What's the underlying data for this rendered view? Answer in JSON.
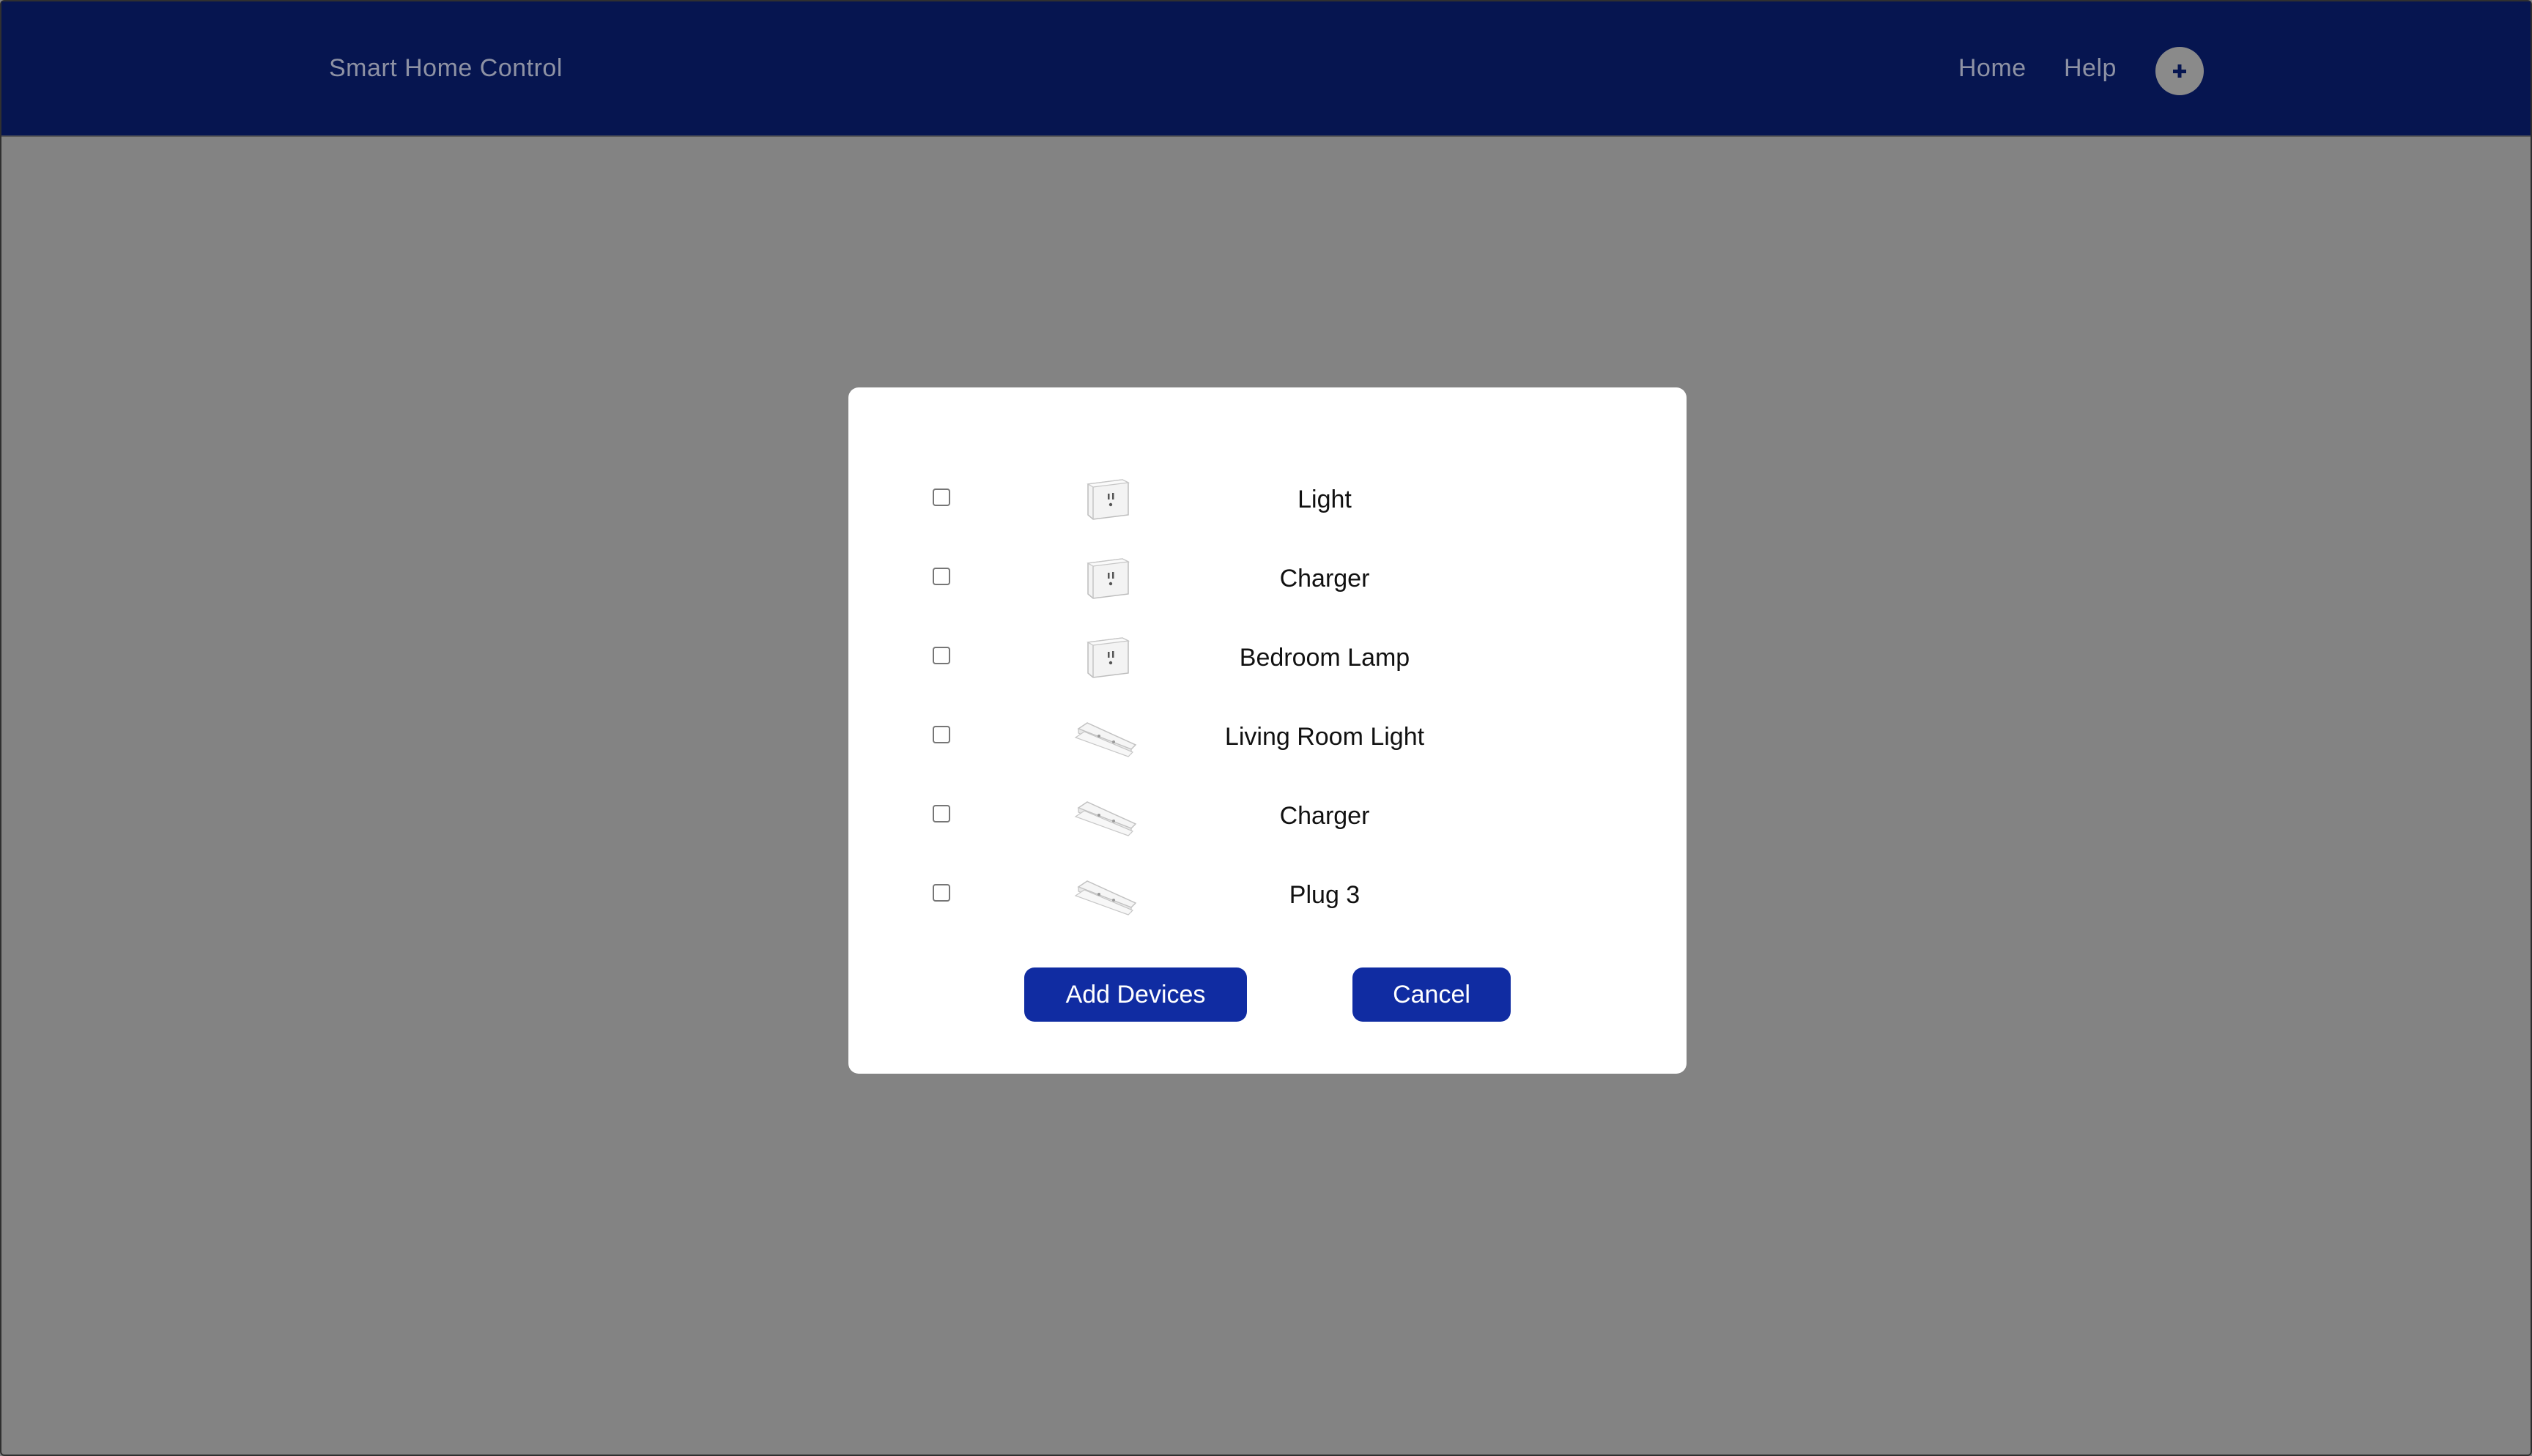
{
  "header": {
    "brand": "Smart Home Control",
    "nav": [
      {
        "label": "Home"
      },
      {
        "label": "Help"
      }
    ],
    "add_icon": "plus-circle-icon"
  },
  "modal": {
    "devices": [
      {
        "label": "Light",
        "icon": "smart-plug-image",
        "checked": false
      },
      {
        "label": "Charger",
        "icon": "smart-plug-image",
        "checked": false
      },
      {
        "label": "Bedroom Lamp",
        "icon": "smart-plug-image",
        "checked": false
      },
      {
        "label": "Living Room Light",
        "icon": "power-strip-image",
        "checked": false
      },
      {
        "label": "Charger",
        "icon": "power-strip-image",
        "checked": false
      },
      {
        "label": "Plug 3",
        "icon": "power-strip-image",
        "checked": false
      }
    ],
    "add_button": "Add Devices",
    "cancel_button": "Cancel"
  },
  "colors": {
    "header_bg": "#061550",
    "overlay_bg": "#838383",
    "button_bg": "#102ca2",
    "nav_text": "#8e92a4"
  }
}
